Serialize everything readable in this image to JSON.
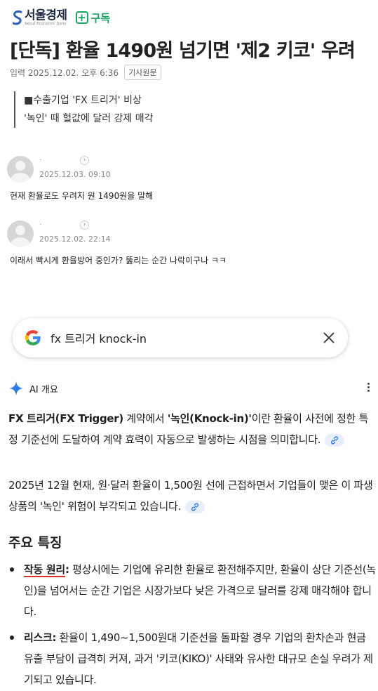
{
  "publisher": {
    "name": "서울경제",
    "tagline": "Seoul Economic Daily",
    "subscribe_label": "구독",
    "subscribe_icon": "plus-box-icon",
    "brand_color": "#1f2a44",
    "accent_color": "#1aa260"
  },
  "article": {
    "headline": "[단독] 환율 1490원 넘기면 '제2 키코' 우려",
    "published": "입력 2025.12.02. 오후 6:36",
    "original_label": "기사원문",
    "summary": [
      "■수출기업 'FX 트리거' 비상",
      "'녹인' 때 헐값에 달러 강제 매각"
    ]
  },
  "comments": [
    {
      "date": "2025.12.03. 09:10",
      "text": "현재 환율로도 우려지 원 1490원을 말해"
    },
    {
      "date": "2025.12.02. 22:14",
      "text": "이래서 빡시게 환율방어 중인가? 뚫리는 순간 나락이구나 ㅋㅋ"
    }
  ],
  "search": {
    "query": "fx 트리거 knock-in",
    "icons": [
      "google-logo-icon",
      "close-icon"
    ]
  },
  "ai_overview": {
    "title": "AI 개요",
    "icons": [
      "sparkle-icon",
      "more-vert-icon",
      "link-icon"
    ],
    "p1": {
      "term1": "FX 트리거(FX Trigger)",
      "t1": " 계약에서 ",
      "term2": "'녹인(Knock-in)'",
      "t2": "이란 환율이 사전에 정한 특정 기준선에 도달하여 계약 효력이 자동으로 발생하는 시점을 의미합니다."
    },
    "p2": "2025년 12월 현재, 원·달러 환율이 1,500원 선에 근접하면서 기업들이 맺은 이 파생상품의 '녹인' 위험이 부각되고 있습니다.",
    "section_title": "주요 특징",
    "bullets": [
      {
        "term": "작동 원리",
        "colon": ":",
        "text": " 평상시에는 기업에 유리한 환율로 환전해주지만, 환율이 상단 기준선(녹인)을 넘어서는 순간 기업은 시장가보다 낮은 가격으로 달러를 강제 매각해야 합니다."
      },
      {
        "term": "리스크",
        "colon": ":",
        "text": " 환율이 1,490~1,500원대 기준선을 돌파할 경우 기업의 환차손과 현금 유출 부담이 급격히 커져, 과거 '키코(KIKO)' 사태와 유사한 대규모 손실 우려가 제기되고 있습니다."
      }
    ]
  }
}
